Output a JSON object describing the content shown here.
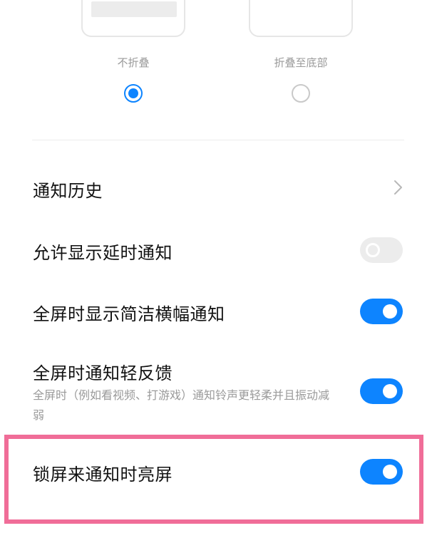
{
  "collapse_options": [
    {
      "label": "不折叠",
      "selected": true
    },
    {
      "label": "折叠至底部",
      "selected": false
    }
  ],
  "accent_color": "#0d84ff",
  "highlight_color": "#f06d98",
  "rows": {
    "history": {
      "title": "通知历史",
      "icon": "chevron-right-icon"
    },
    "delayed": {
      "title": "允许显示延时通知",
      "enabled": false
    },
    "banner": {
      "title": "全屏时显示简洁横幅通知",
      "enabled": true
    },
    "feedback": {
      "title": "全屏时通知轻反馈",
      "subtitle": "全屏时（例如看视频、打游戏）通知铃声更轻柔并且振动减弱",
      "enabled": true
    },
    "lockscreen": {
      "title": "锁屏来通知时亮屏",
      "enabled": true
    }
  }
}
